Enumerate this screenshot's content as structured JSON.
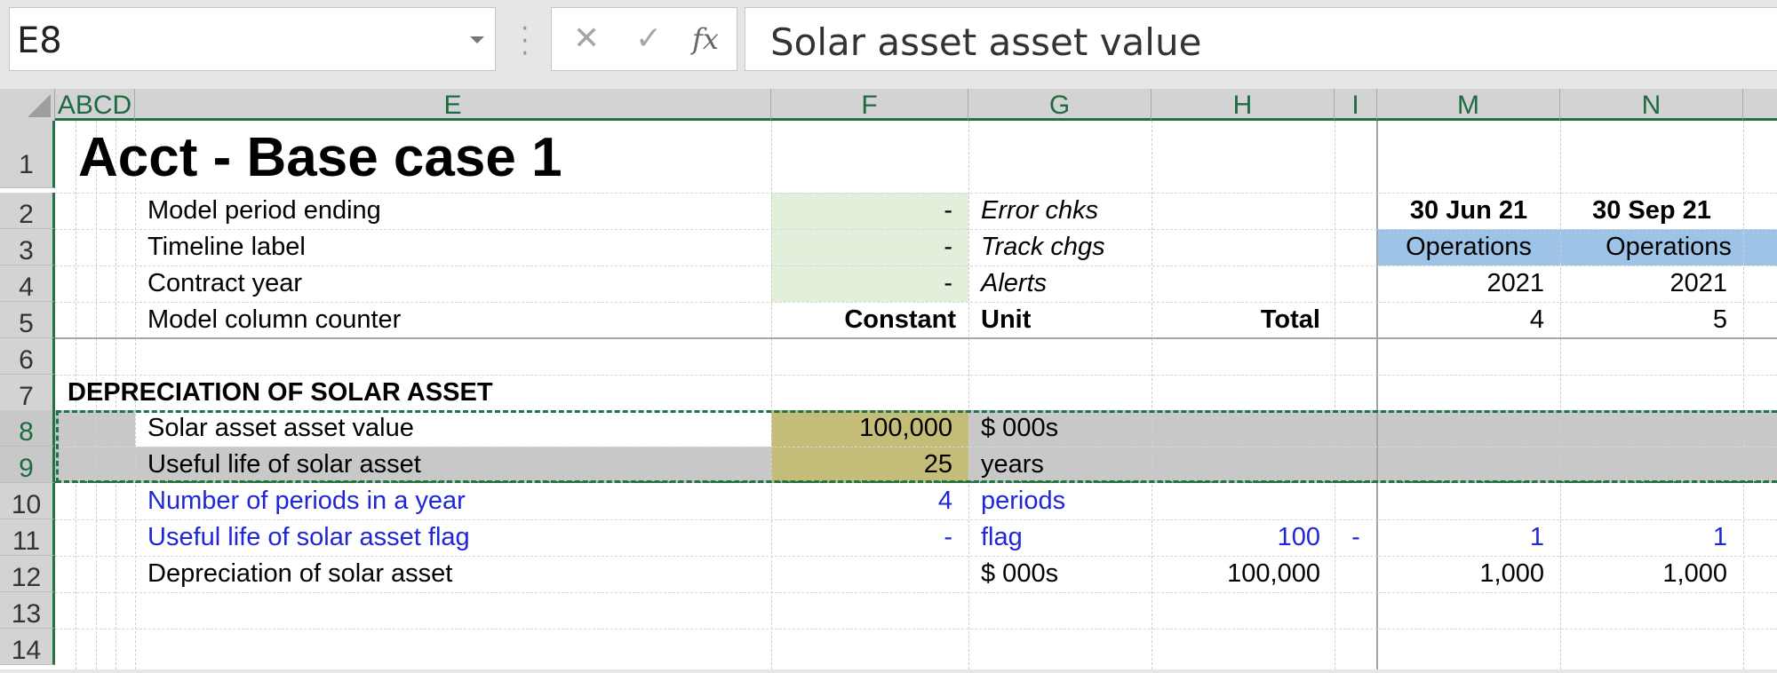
{
  "formula_bar": {
    "name_box": "E8",
    "cancel_glyph": "✕",
    "enter_glyph": "✓",
    "fx_label": "fx",
    "content": "Solar asset asset value"
  },
  "columns": [
    "ABCD",
    "E",
    "F",
    "G",
    "H",
    "I",
    "M",
    "N"
  ],
  "rows": [
    "1",
    "2",
    "3",
    "4",
    "5",
    "6",
    "7",
    "8",
    "9",
    "10",
    "11",
    "12",
    "13",
    "14"
  ],
  "sheet": {
    "title": "Acct - Base case 1",
    "model_period_ending": {
      "label": "Model period ending",
      "f": "-",
      "g": "Error chks",
      "m": "30 Jun 21",
      "n": "30 Sep 21"
    },
    "timeline_label": {
      "label": "Timeline label",
      "f": "-",
      "g": "Track chgs",
      "m": "Operations",
      "n": "Operations"
    },
    "contract_year": {
      "label": "Contract year",
      "f": "-",
      "g": "Alerts",
      "m": "2021",
      "n": "2021"
    },
    "column_counter": {
      "label": "Model column counter",
      "f": "Constant",
      "g": "Unit",
      "h": "Total",
      "m": "4",
      "n": "5"
    },
    "section": "DEPRECIATION OF SOLAR ASSET",
    "asset_value": {
      "label": "Solar asset asset value",
      "f": "100,000",
      "g": "$ 000s"
    },
    "useful_life": {
      "label": "Useful life of solar asset",
      "f": "25",
      "g": "years"
    },
    "periods": {
      "label": "Number of periods in a year",
      "f": "4",
      "g": "periods"
    },
    "life_flag": {
      "label": "Useful life of solar asset flag",
      "f": "-",
      "g": "flag",
      "h": "100",
      "i": "-",
      "m": "1",
      "n": "1"
    },
    "depreciation": {
      "label": "Depreciation of solar asset",
      "g": "$ 000s",
      "h": "100,000",
      "m": "1,000",
      "n": "1,000"
    }
  },
  "colors": {
    "input_green": "#e2efda",
    "input_olive": "#c4bd79",
    "selection_gray": "#c8c8c8",
    "timeline_blue": "#9dc3e6",
    "excel_green": "#217346",
    "link_blue": "#1f26d6"
  }
}
